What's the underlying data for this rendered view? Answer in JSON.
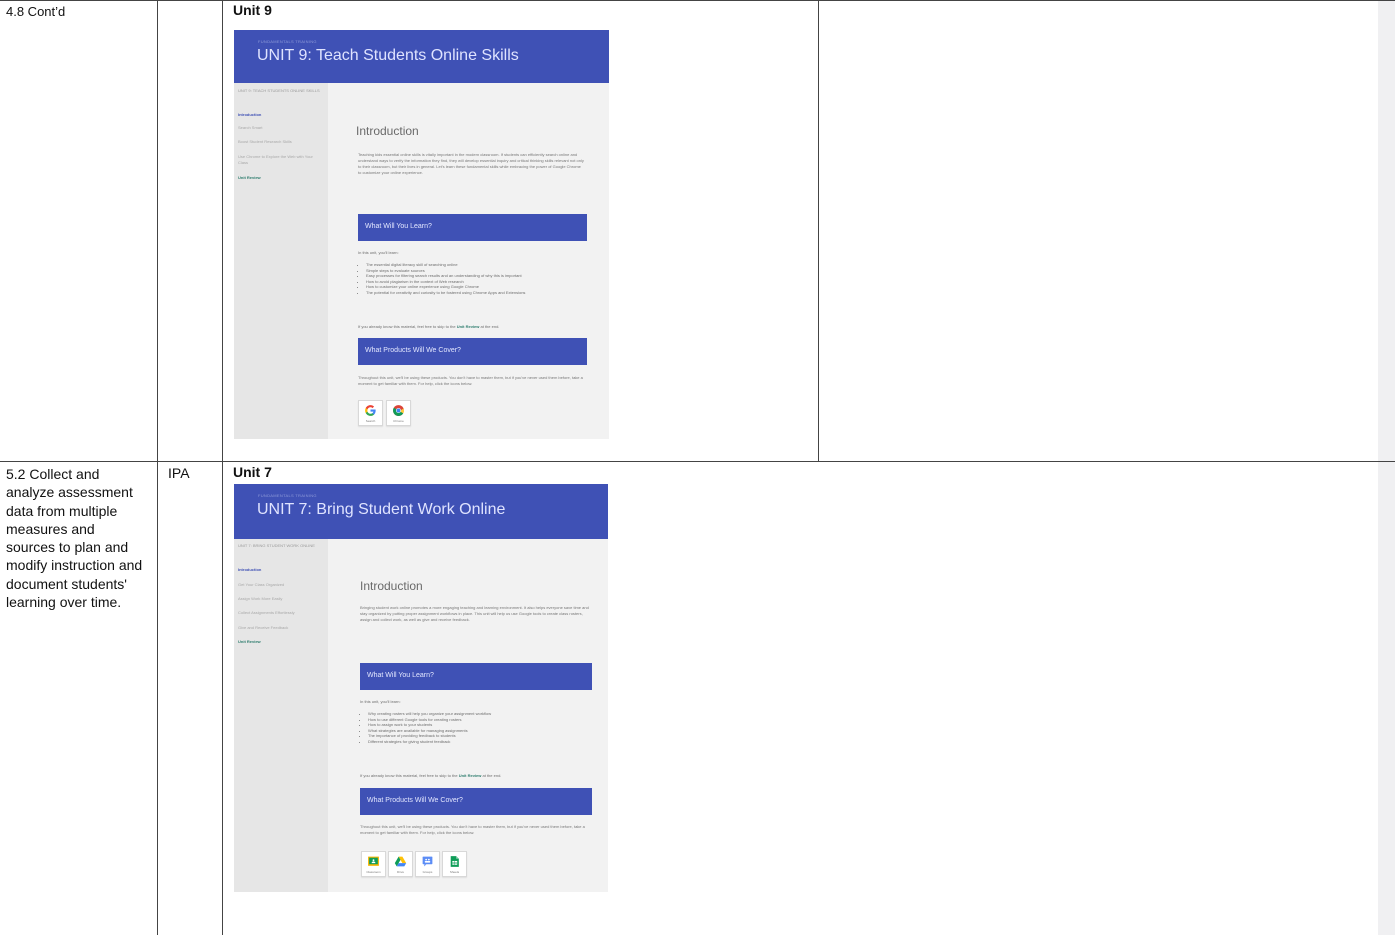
{
  "rows": [
    {
      "standard": "4.8 Cont’d",
      "code": "",
      "unit_heading": "Unit 9",
      "shot": {
        "breadcrumb": "FUNDAMENTALS TRAINING",
        "title": "UNIT 9: Teach Students Online Skills",
        "sidebar_heading": "UNIT 9: TEACH STUDENTS ONLINE SKILLS",
        "sidebar_items": [
          {
            "label": "Introduction",
            "state": "active"
          },
          {
            "label": "Search Smart",
            "state": "normal"
          },
          {
            "label": "Boost Student Research Skills",
            "state": "normal"
          },
          {
            "label": "Use Chrome to Explore the Web with Your Class",
            "state": "normal"
          },
          {
            "label": "Unit Review",
            "state": "teal"
          }
        ],
        "intro_heading": "Introduction",
        "intro_text": "Teaching kids essential online skills is vitally important in the modern classroom. If students can efficiently search online and understand ways to verify the information they find, they will develop essential inquiry and critical thinking skills relevant not only to their classroom, but their lives in general. Let's learn these fundamental skills while embracing the power of Google Chrome to customize your online experience.",
        "learn_heading": "What Will You Learn?",
        "learn_lead": "In this unit, you'll learn:",
        "learn_items": [
          "The essential digital literacy skill of searching online",
          "Simple steps to evaluate sources",
          "Easy processes for filtering search results and an understanding of why this is important",
          "How to avoid plagiarism in the context of Web research",
          "How to customize your online experience using Google Chrome",
          "The potential for creativity and curiosity to be fostered using Chrome Apps and Extensions"
        ],
        "skip_before": "If you already know this material, feel free to skip to the ",
        "skip_link": "Unit Review",
        "skip_after": " at the end.",
        "products_heading": "What Products Will We Cover?",
        "products_text": "Throughout this unit, we'll be using these products. You don't have to master them, but if you've never used them before, take a moment to get familiar with them. For help, click the icons below.",
        "products": [
          {
            "label": "Search",
            "icon": "google-g-icon"
          },
          {
            "label": "Chrome",
            "icon": "chrome-icon"
          }
        ]
      }
    },
    {
      "standard": "5.2 Collect and analyze assessment data from multiple measures and sources to plan and modify instruction and document students' learning over time.",
      "code": "IPA",
      "unit_heading": "Unit 7",
      "shot": {
        "breadcrumb": "FUNDAMENTALS TRAINING",
        "title": "UNIT 7: Bring Student Work Online",
        "sidebar_heading": "UNIT 7: BRING STUDENT WORK ONLINE",
        "sidebar_items": [
          {
            "label": "Introduction",
            "state": "active"
          },
          {
            "label": "Get Your Class Organized",
            "state": "normal"
          },
          {
            "label": "Assign Work More Easily",
            "state": "normal"
          },
          {
            "label": "Collect Assignments Effortlessly",
            "state": "normal"
          },
          {
            "label": "Give and Receive Feedback",
            "state": "normal"
          },
          {
            "label": "Unit Review",
            "state": "teal"
          }
        ],
        "intro_heading": "Introduction",
        "intro_text": "Bringing student work online promotes a more engaging teaching and learning environment. It also helps everyone save time and stay organized by putting proper assignment workflows in place. This unit will help us use Google tools to create class rosters, assign and collect work, as well as give and receive feedback.",
        "learn_heading": "What Will You Learn?",
        "learn_lead": "In this unit, you'll learn:",
        "learn_items": [
          "Why creating rosters will help you organize your assignment workflow",
          "How to use different Google tools for creating rosters",
          "How to assign work to your students",
          "What strategies are available for managing assignments",
          "The importance of providing feedback to students",
          "Different strategies for giving student feedback"
        ],
        "skip_before": "If you already know this material, feel free to skip to the ",
        "skip_link": "Unit Review",
        "skip_after": " at the end.",
        "products_heading": "What Products Will We Cover?",
        "products_text": "Throughout this unit, we'll be using these products. You don't have to master them, but if you've never used them before, take a moment to get familiar with them. For help, click the icons below.",
        "products": [
          {
            "label": "Classroom",
            "icon": "classroom-icon"
          },
          {
            "label": "Drive",
            "icon": "drive-icon"
          },
          {
            "label": "Groups",
            "icon": "groups-icon"
          },
          {
            "label": "Sheets",
            "icon": "sheets-icon"
          }
        ]
      }
    }
  ],
  "colors": {
    "banner": "#3f51b5",
    "accent_link": "#2e7d6e",
    "sidebar_bg": "#e6e6e6",
    "content_bg": "#f2f2f2"
  }
}
